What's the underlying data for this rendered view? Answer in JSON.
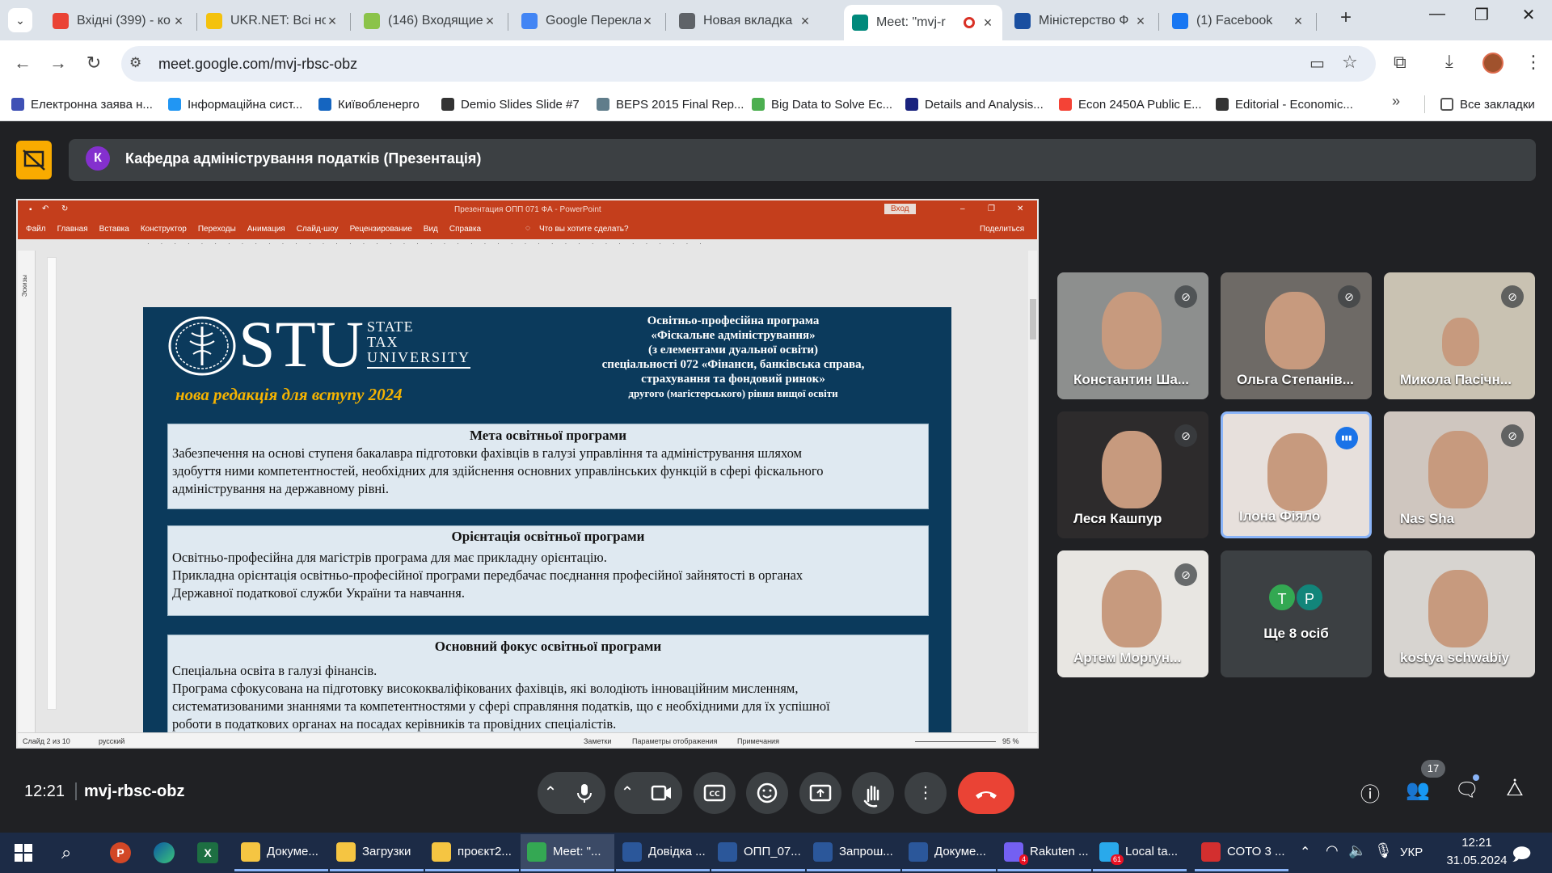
{
  "browser": {
    "tabs": [
      {
        "title": "Вхідні (399) - ко",
        "icon": "gmail-icon",
        "color": "#ea4335"
      },
      {
        "title": "UKR.NET: Всі нов",
        "icon": "ukrnet-icon",
        "color": "#f4c20d"
      },
      {
        "title": "(146) Входящие",
        "icon": "mail-icon",
        "color": "#8bc34a"
      },
      {
        "title": "Google Перекла",
        "icon": "translate-icon",
        "color": "#4285f4"
      },
      {
        "title": "Новая вкладка",
        "icon": "chrome-icon",
        "color": "#5f6368"
      },
      {
        "title": "Meet: \"mvj-r",
        "icon": "meet-icon",
        "color": "#00897b"
      },
      {
        "title": "Міністерство Ф",
        "icon": "ministry-icon",
        "color": "#1a4fa0"
      },
      {
        "title": "(1) Facebook",
        "icon": "facebook-icon",
        "color": "#1877f2"
      }
    ],
    "url": "meet.google.com/mvj-rbsc-obz",
    "bookmarks": [
      {
        "label": "Електронна заява н...",
        "color": "#3f51b5"
      },
      {
        "label": "Інформаційна сист...",
        "color": "#2196f3"
      },
      {
        "label": "Київобленерго",
        "color": "#1565c0"
      },
      {
        "label": "Demio Slides Slide #7",
        "color": "#333333"
      },
      {
        "label": "BEPS 2015 Final Rep...",
        "color": "#607d8b"
      },
      {
        "label": "Big Data to Solve Ec...",
        "color": "#4caf50"
      },
      {
        "label": "Details and Analysis...",
        "color": "#1a237e"
      },
      {
        "label": "Econ 2450A Public E...",
        "color": "#f44336"
      },
      {
        "label": "Editorial - Economic...",
        "color": "#333333"
      }
    ],
    "all_bookmarks": "Все закладки"
  },
  "meet": {
    "presenter_initial": "К",
    "presentation_title": "Кафедра адміністрування податків (Презентація)",
    "time": "12:21",
    "meeting_code": "mvj-rbsc-obz",
    "participants_count": "17",
    "accent_hangup": "#ea4335",
    "tiles": [
      {
        "name": "Константин Ша...",
        "muted": true
      },
      {
        "name": "Ольга Степанів...",
        "muted": true
      },
      {
        "name": "Микола Пасічн...",
        "muted": true
      },
      {
        "name": "Леся Кашпур",
        "muted": true
      },
      {
        "name": "Ілона Фіяло",
        "muted": false,
        "speaking": true
      },
      {
        "name": "Nas Sha",
        "muted": true
      },
      {
        "name": "Артем Моргун...",
        "muted": true
      },
      {
        "name": "Ще 8 осіб",
        "avatars": [
          "Т",
          "Р"
        ]
      },
      {
        "name": "kostya schwabiy",
        "muted": false
      }
    ]
  },
  "powerpoint": {
    "window_title": "Презентация ОПП 071 ФА  -  PowerPoint",
    "login": "Вход",
    "ribbon": [
      "Файл",
      "Главная",
      "Вставка",
      "Конструктор",
      "Переходы",
      "Анимация",
      "Слайд-шоу",
      "Рецензирование",
      "Вид",
      "Справка"
    ],
    "tell_me": "Что вы хотите сделать?",
    "share": "Поделиться",
    "thumbs_label": "Эскизы",
    "status": {
      "slide": "Слайд 2 из 10",
      "lang": "русский",
      "notes": "Заметки",
      "display": "Параметры отображения",
      "comments": "Примечания",
      "zoom": "95 %"
    },
    "slide": {
      "logo": "STU",
      "logo_line1": "STATE",
      "logo_line2": "TAX",
      "logo_line3": "UNIVERSITY",
      "edition": "нова редакція для вступу 2024",
      "header": [
        "Освітньо-професійна програма",
        "«Фіскальне адміністрування»",
        "(з елементами дуальної освіти)",
        "спеціальності 072 «Фінанси, банківська справа,",
        "страхування та фондовий ринок»",
        "другого (магістерського) рівня вищої освіти"
      ],
      "boxes": [
        {
          "heading": "Мета освітньої програми",
          "lines": [
            "Забезпечення на основі ступеня бакалавра підготовки фахівців в галузі управління та адміністрування шляхом",
            "здобуття ними компетентностей, необхідних для здійснення основних управлінських функцій в сфері фіскального",
            "адміністрування на державному рівні."
          ]
        },
        {
          "heading": "Орієнтація освітньої програми",
          "lines": [
            "Освітньо-професійна для магістрів програма для має прикладну орієнтацію.",
            "Прикладна орієнтація освітньо-професійної програми передбачає поєднання професійної зайнятості в органах",
            "Державної податкової служби України та навчання."
          ]
        },
        {
          "heading": "Основний фокус освітньої програми",
          "lines": [
            "Спеціальна освіта в галузі фінансів.",
            "Програма сфокусована на підготовку висококваліфікованих фахівців, які володіють інноваційним мисленням,",
            "систематизованими знаннями та компетентностями у сфері справляння податків, що є необхідними для їх успішної",
            "роботи в податкових органах на посадах керівників та провідних спеціалістів."
          ]
        }
      ]
    }
  },
  "taskbar": {
    "items": [
      {
        "label": "Докуме...",
        "color": "#f5c542"
      },
      {
        "label": "Загрузки",
        "color": "#f5c542"
      },
      {
        "label": "проєкт2...",
        "color": "#f5c542"
      },
      {
        "label": "Meet: \"...",
        "color": "#34a853"
      },
      {
        "label": "Довідка ...",
        "color": "#2b579a"
      },
      {
        "label": "ОПП_07...",
        "color": "#2b579a"
      },
      {
        "label": "Запрош...",
        "color": "#2b579a"
      },
      {
        "label": "Докуме...",
        "color": "#2b579a"
      },
      {
        "label": "Rakuten ...",
        "color": "#7360f2"
      },
      {
        "label": "Local ta...",
        "color": "#29a9eb"
      },
      {
        "label": "СОТО 3 ...",
        "color": "#d32f2f"
      }
    ],
    "lang": "УКР",
    "clock_time": "12:21",
    "clock_date": "31.05.2024",
    "viber_badge": "4",
    "telegram_badge": "61"
  }
}
